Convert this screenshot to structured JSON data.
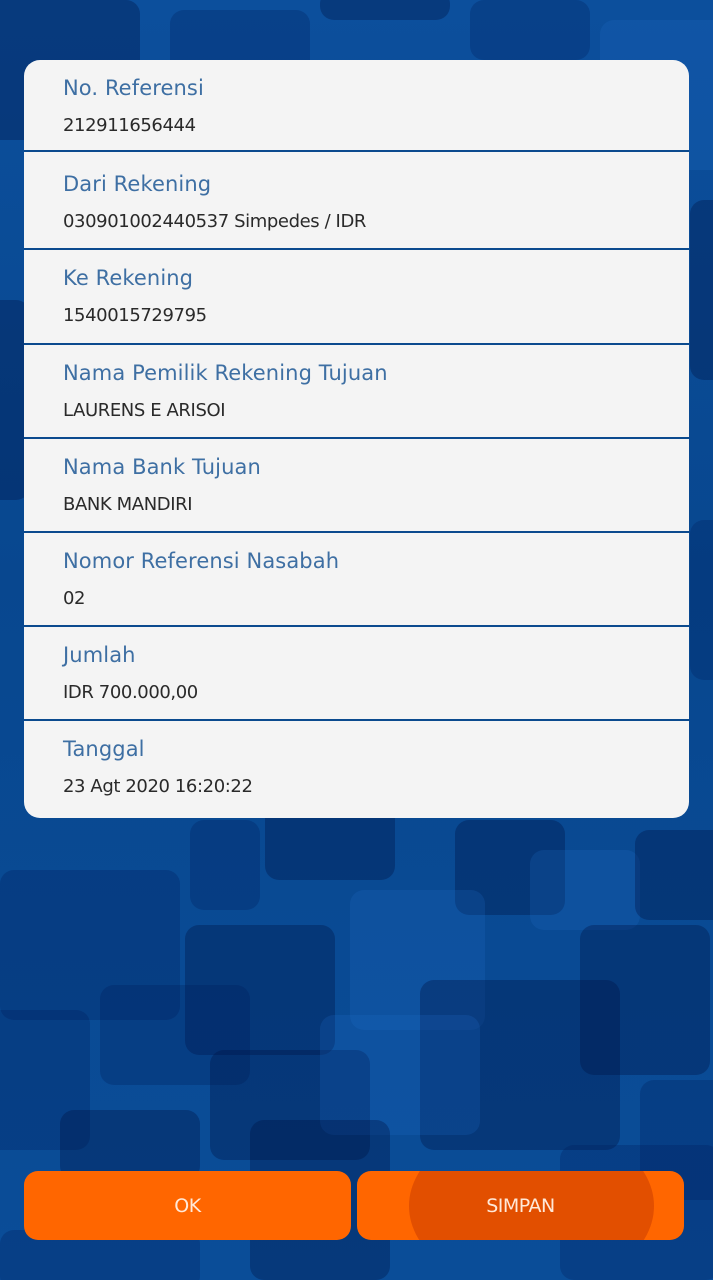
{
  "details": [
    {
      "label": "No. Referensi",
      "value": "212911656444"
    },
    {
      "label": "Dari Rekening",
      "value": "030901002440537  Simpedes / IDR"
    },
    {
      "label": "Ke Rekening",
      "value": "1540015729795"
    },
    {
      "label": "Nama Pemilik Rekening Tujuan",
      "value": "LAURENS E ARISOI"
    },
    {
      "label": "Nama Bank Tujuan",
      "value": "BANK MANDIRI"
    },
    {
      "label": "Nomor Referensi Nasabah",
      "value": "02"
    },
    {
      "label": "Jumlah",
      "value": "IDR 700.000,00"
    },
    {
      "label": "Tanggal",
      "value": "23 Agt 2020 16:20:22"
    }
  ],
  "buttons": {
    "ok_label": "OK",
    "save_label": "SIMPAN"
  },
  "colors": {
    "background": "#0a4a93",
    "card": "#f4f4f4",
    "label": "#3e6fa3",
    "divider": "#0b4a8e",
    "button": "#ff6600"
  }
}
